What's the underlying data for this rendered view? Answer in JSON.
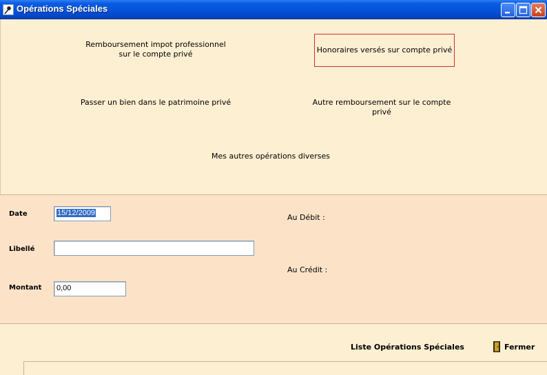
{
  "window": {
    "title": "Opérations Spéciales",
    "icon": "pin-icon",
    "controls": [
      "minimize-icon",
      "maximize-icon",
      "close-icon"
    ]
  },
  "operations": {
    "remboursement_impot_line1": "Remboursement impot professionnel",
    "remboursement_impot_line2": "sur le compte privé",
    "honoraires": "Honoraires versés sur compte privé",
    "passer_bien": "Passer un bien dans le patrimoine privé",
    "autre_remboursement": "Autre remboursement sur le compte privé",
    "autres_operations": "Mes autres opérations diverses"
  },
  "form": {
    "date_label": "Date",
    "date_value": "15/12/2009",
    "libelle_label": "Libellé",
    "libelle_value": "",
    "montant_label": "Montant",
    "montant_value": "0,00",
    "debit_label": "Au Débit :",
    "credit_label": "Au Crédit :"
  },
  "footer": {
    "liste_label": "Liste Opérations Spéciales",
    "fermer_label": "Fermer",
    "fermer_icon": "door-icon"
  },
  "colors": {
    "titlebar": "#0453D8",
    "panel_top": "#FDEFD1",
    "panel_form": "#FCE3C8",
    "selection_border": "#D12D2D",
    "date_highlight": "#316AC5"
  }
}
